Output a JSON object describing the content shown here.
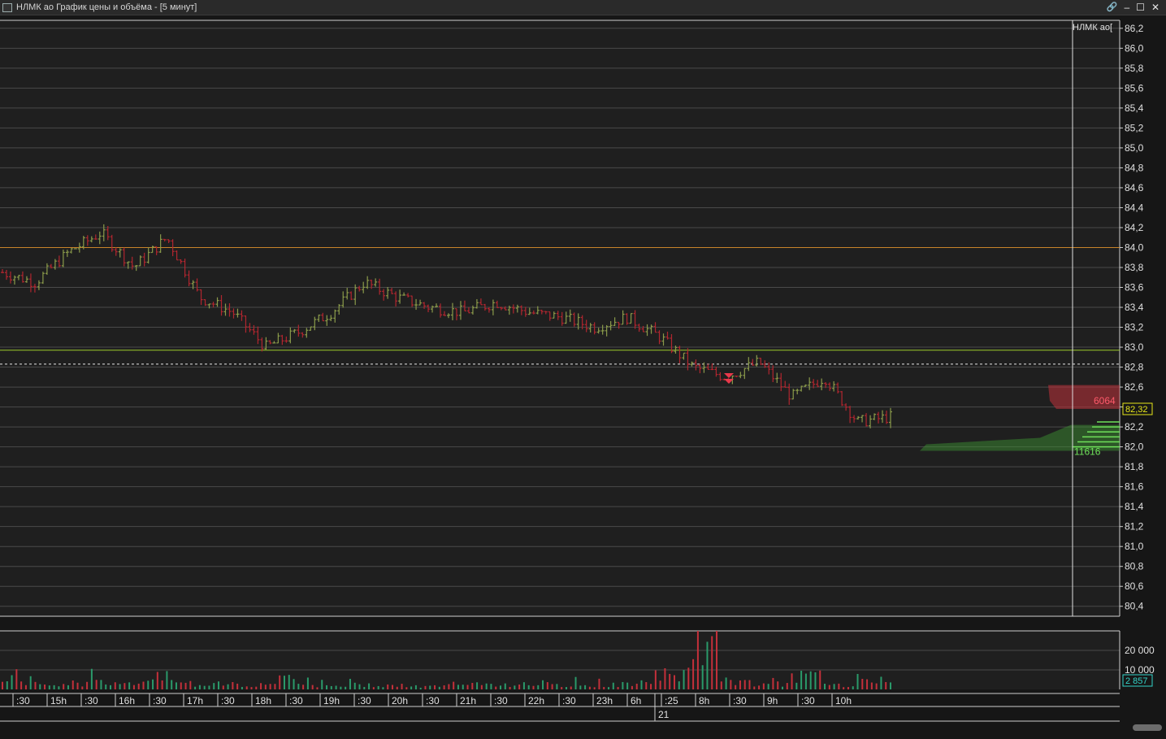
{
  "window": {
    "title": "НЛМК ао График цены и объёма - [5 минут]",
    "controls": {
      "link": "🔗",
      "minimize": "–",
      "maximize": "☐",
      "close": "✕"
    }
  },
  "chart_data": {
    "type": "candlestick",
    "ticker_label": "НЛМК ао[",
    "price_axis": {
      "ticks": [
        "86,2",
        "86,0",
        "85,8",
        "85,6",
        "85,4",
        "85,2",
        "85,0",
        "84,8",
        "84,6",
        "84,4",
        "84,2",
        "84,0",
        "83,8",
        "83,6",
        "83,4",
        "83,2",
        "83,0",
        "82,8",
        "82,6",
        "82,4",
        "82,2",
        "82,0",
        "81,8",
        "81,6",
        "81,4",
        "81,2",
        "81,0",
        "80,8",
        "80,6",
        "80,4"
      ],
      "min": 80.3,
      "max": 86.28,
      "current_price_label": "82,32",
      "current_price": 82.32
    },
    "horizontal_levels": [
      {
        "price": 84.0,
        "color": "#c8842a",
        "style": "solid"
      },
      {
        "price": 82.97,
        "color": "#9ecb2a",
        "style": "solid"
      },
      {
        "price": 82.83,
        "color": "#e8e8e8",
        "style": "dashed"
      }
    ],
    "order_book": {
      "ask_volume_label": "6064",
      "bid_volume_label": "11616",
      "ask_color": "#c0313a",
      "bid_color": "#3f9a33"
    },
    "time_axis": {
      "labels": [
        ":30",
        "15h",
        ":30",
        "16h",
        ":30",
        "17h",
        ":30",
        "18h",
        ":30",
        "19h",
        ":30",
        "20h",
        ":30",
        "21h",
        ":30",
        "22h",
        ":30",
        "23h",
        "6h",
        ":25",
        "8h",
        ":30",
        "9h",
        ":30",
        "10h"
      ],
      "date_label": "21"
    },
    "volume_axis": {
      "ticks": [
        "20 000",
        "10 000"
      ],
      "max": 30000,
      "current_volume_label": "2 857"
    },
    "price_anchors": [
      83.75,
      83.65,
      83.95,
      84.15,
      83.8,
      84.1,
      83.5,
      83.35,
      83.0,
      83.15,
      83.35,
      83.65,
      83.5,
      83.4,
      83.35,
      83.45,
      83.35,
      83.3,
      83.2,
      83.3,
      83.1,
      82.8,
      82.7,
      82.85,
      82.5,
      82.7,
      82.25,
      82.3
    ],
    "volume_anchors": [
      6000,
      2500,
      4000,
      3000,
      8000,
      3500,
      4500,
      3000,
      6000,
      2500,
      3000,
      2500,
      2000,
      3500,
      2500,
      4000,
      2500,
      3000,
      3500,
      9000,
      26000,
      5000,
      4000,
      8000,
      3000,
      7000,
      3000
    ]
  }
}
